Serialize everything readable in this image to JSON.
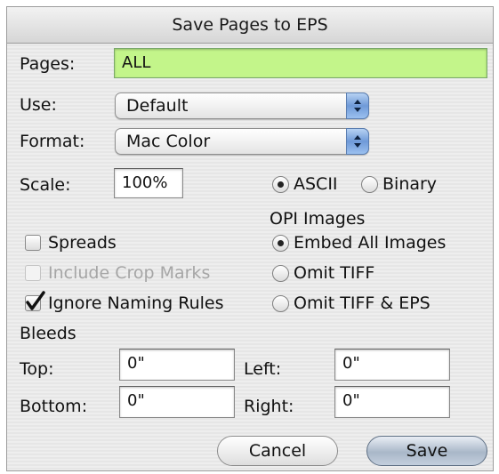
{
  "dialog": {
    "title": "Save Pages to EPS"
  },
  "pages": {
    "label": "Pages:",
    "value": "ALL"
  },
  "use": {
    "label": "Use:",
    "selected": "Default"
  },
  "format": {
    "label": "Format:",
    "selected": "Mac Color"
  },
  "scale": {
    "label": "Scale:",
    "value": "100%"
  },
  "encoding": {
    "ascii_label": "ASCII",
    "binary_label": "Binary",
    "selected": "ASCII"
  },
  "opi": {
    "heading": "OPI Images",
    "options": [
      "Embed All Images",
      "Omit TIFF",
      "Omit TIFF & EPS"
    ],
    "selected": "Embed All Images"
  },
  "checkboxes": {
    "spreads": {
      "label": "Spreads",
      "checked": false,
      "enabled": true
    },
    "crop_marks": {
      "label": "Include Crop Marks",
      "checked": false,
      "enabled": false
    },
    "naming_rules": {
      "label": "Ignore Naming Rules",
      "checked": true,
      "enabled": true
    }
  },
  "bleeds": {
    "heading": "Bleeds",
    "top_label": "Top:",
    "top": "0\"",
    "left_label": "Left:",
    "left": "0\"",
    "bottom_label": "Bottom:",
    "bottom": "0\"",
    "right_label": "Right:",
    "right": "0\""
  },
  "buttons": {
    "cancel": "Cancel",
    "save": "Save"
  },
  "icons": {
    "arrows": "popup-arrows-icon",
    "check": "checkmark-icon"
  },
  "colors": {
    "pages_field": "#c3f58a",
    "popup_arrows": "#6f9ad8"
  }
}
